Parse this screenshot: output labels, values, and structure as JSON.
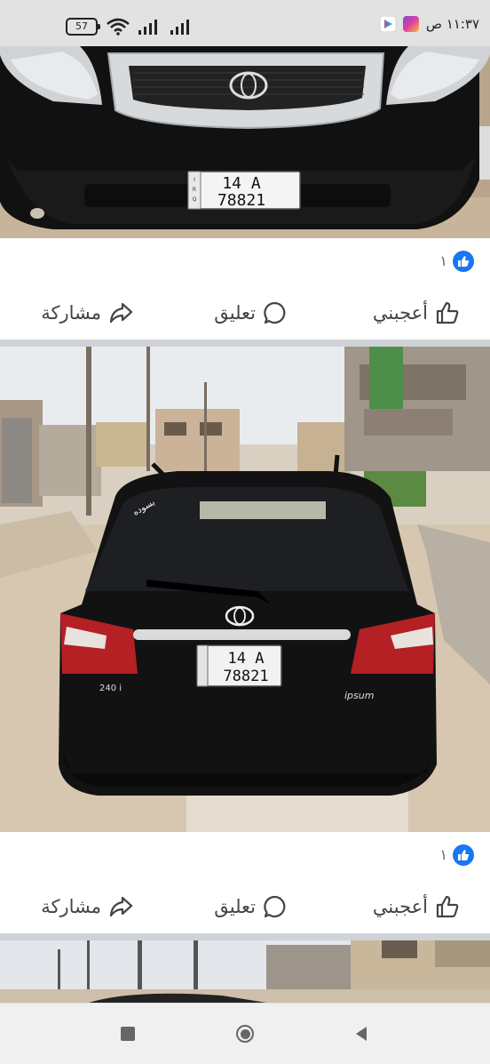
{
  "status_bar": {
    "battery": "57",
    "time": "١١:٣٧ ص"
  },
  "posts": [
    {
      "reaction_count": "١",
      "like_label": "أعجبني",
      "comment_label": "تعليق",
      "share_label": "مشاركة"
    },
    {
      "reaction_count": "١",
      "like_label": "أعجبني",
      "comment_label": "تعليق",
      "share_label": "مشاركة"
    }
  ],
  "photos": {
    "plate_number": "14 A",
    "plate_code": "78821",
    "plate_country": "IRQ",
    "rear_badge_left": "240 i",
    "rear_badge_right": "ipsum",
    "sticker": "بسوده"
  },
  "colors": {
    "like_blue": "#1877f2",
    "separator": "#cfd2d6",
    "text": "#444444"
  },
  "nav_icons": [
    "recents-icon",
    "home-icon",
    "back-icon"
  ]
}
